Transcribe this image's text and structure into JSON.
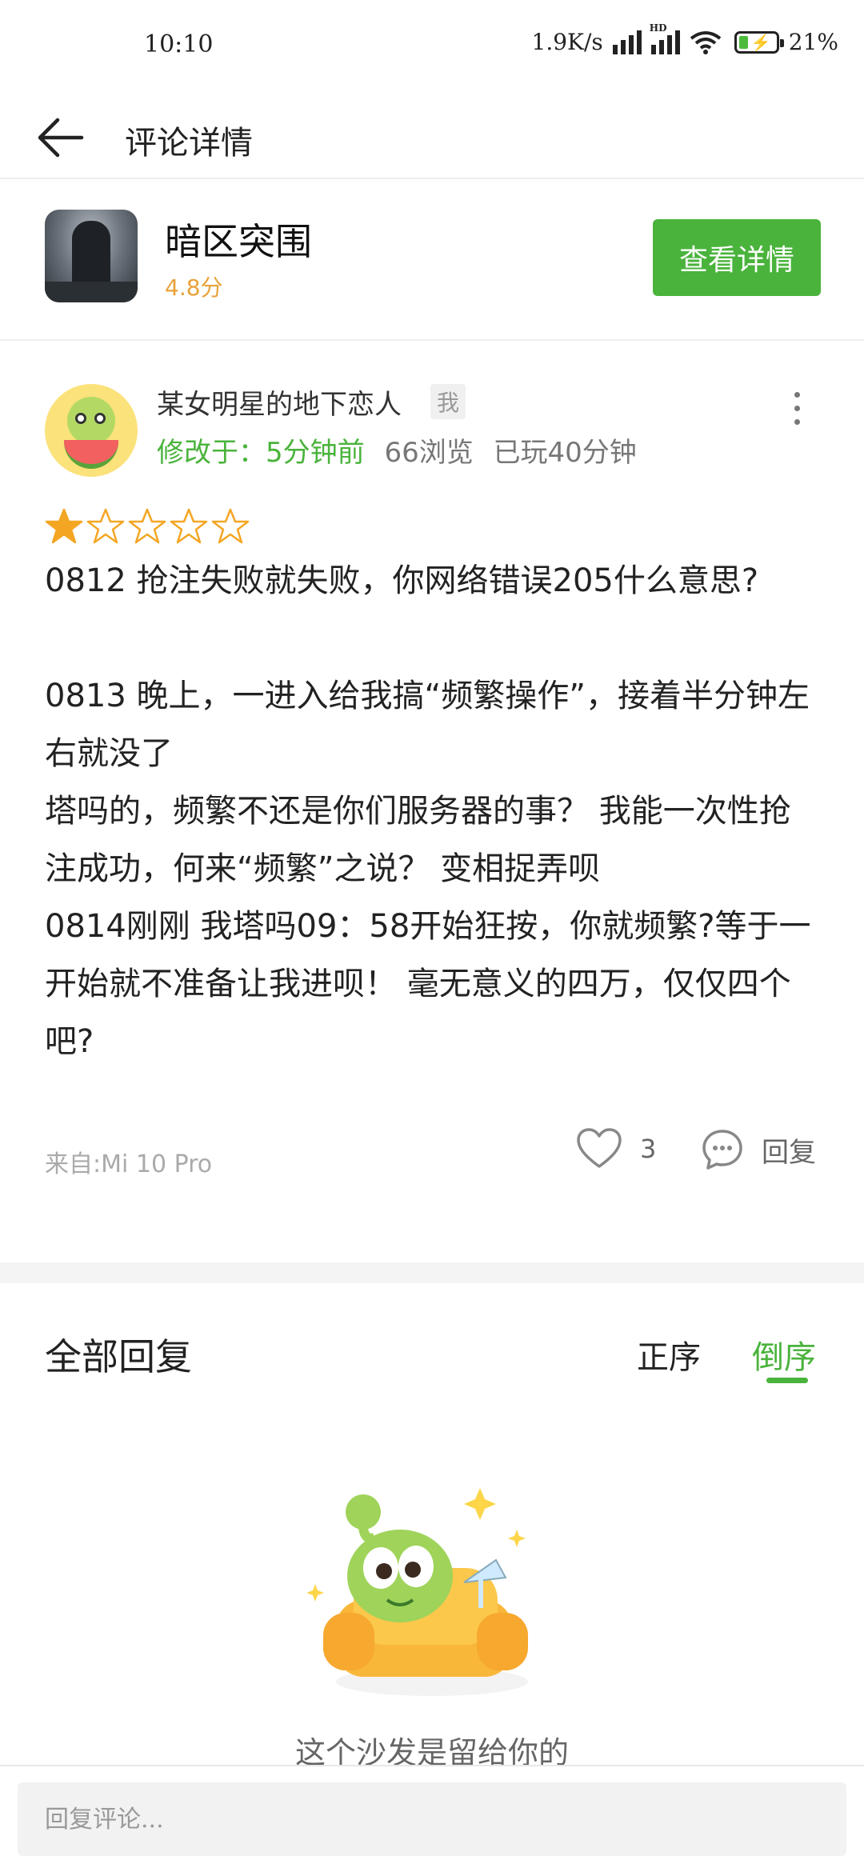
{
  "status_bar": {
    "time": "10:10",
    "network_speed": "1.9K/s",
    "hd_label": "HD",
    "battery": "21%",
    "icons": [
      "signal-icon",
      "hd-signal-icon",
      "wifi-icon",
      "battery-charging-icon"
    ]
  },
  "header": {
    "title": "评论详情",
    "back_icon": "arrow-left-icon"
  },
  "app": {
    "name": "暗区突围",
    "score": "4.8分",
    "detail_button": "查看详情"
  },
  "comment": {
    "username": "某女明星的地下恋人",
    "me_badge": "我",
    "modified": "修改于：5分钟前",
    "views": "66浏览",
    "played": "已玩40分钟",
    "rating": 1,
    "rating_max": 5,
    "text": "0812 抢注失败就失败，你网络错误205什么意思?\n\n0813 晚上，一进入给我搞“频繁操作”，接着半分钟左右就没了\n塔吗的，频繁不还是你们服务器的事？ 我能一次性抢注成功，何来“频繁”之说？ 变相捉弄呗\n0814刚刚 我塔吗09：58开始狂按，你就频繁?等于一开始就不准备让我进呗！ 毫无意义的四万，仅仅四个吧?",
    "device": "来自:Mi 10 Pro",
    "likes": "3",
    "reply_label": "回复"
  },
  "replies": {
    "title": "全部回复",
    "sort_asc": "正序",
    "sort_desc": "倒序",
    "active_sort": "倒序",
    "empty_text": "这个沙发是留给你的"
  },
  "bottom_bar": {
    "placeholder": "回复评论..."
  },
  "colors": {
    "accent_green": "#4ab33c",
    "score_orange": "#e8a23a",
    "star_filled": "#f4a623"
  }
}
